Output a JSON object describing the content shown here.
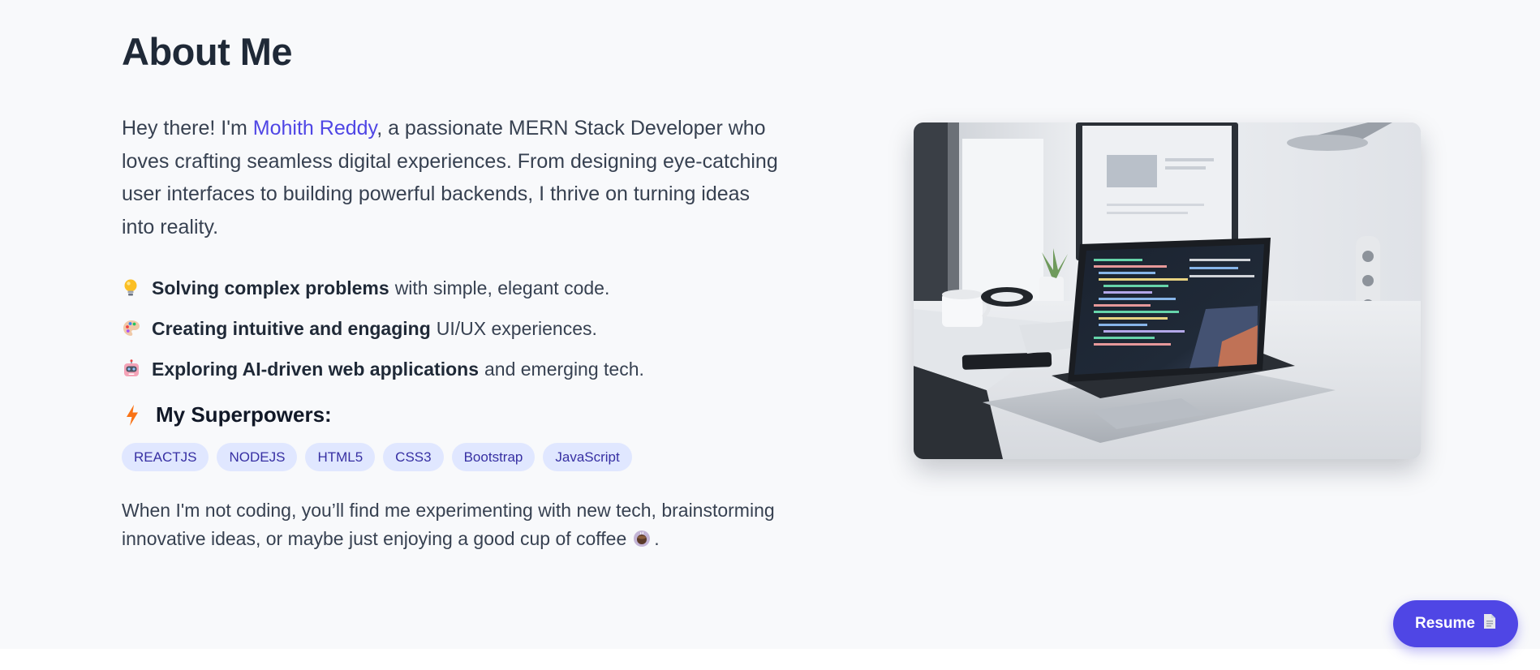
{
  "about": {
    "title": "About Me",
    "intro": {
      "before_name": "Hey there! I'm ",
      "name": "Mohith Reddy",
      "after_name": ", a passionate MERN Stack Developer who loves crafting seamless digital experiences. From designing eye-catching user interfaces to building powerful backends, I thrive on turning ideas into reality."
    },
    "highlights": [
      {
        "icon": "lightbulb-icon",
        "bold": "Solving complex problems",
        "rest": "with simple, elegant code."
      },
      {
        "icon": "palette-icon",
        "bold": "Creating intuitive and engaging",
        "rest": "UI/UX experiences."
      },
      {
        "icon": "robot-icon",
        "bold": "Exploring AI-driven web applications",
        "rest": "and emerging tech."
      }
    ],
    "superpowers": {
      "icon": "lightning-icon",
      "heading": "My Superpowers:",
      "skills": [
        "REACTJS",
        "NODEJS",
        "HTML5",
        "CSS3",
        "Bootstrap",
        "JavaScript"
      ]
    },
    "outro": {
      "text": "When I'm not coding, you’ll find me experimenting with new tech, brainstorming innovative ideas, or maybe just enjoying a good cup of coffee",
      "icon": "coffee-icon",
      "end": "."
    },
    "image": {
      "subject": "laptop on desk"
    }
  },
  "resume_button": {
    "label": "Resume",
    "icon": "document-icon"
  },
  "colors": {
    "accent": "#4f46e5",
    "chip_bg": "#e0e7ff",
    "chip_text": "#3730a3",
    "heading": "#1f2937",
    "body": "#374151",
    "background": "#f8f9fb"
  }
}
